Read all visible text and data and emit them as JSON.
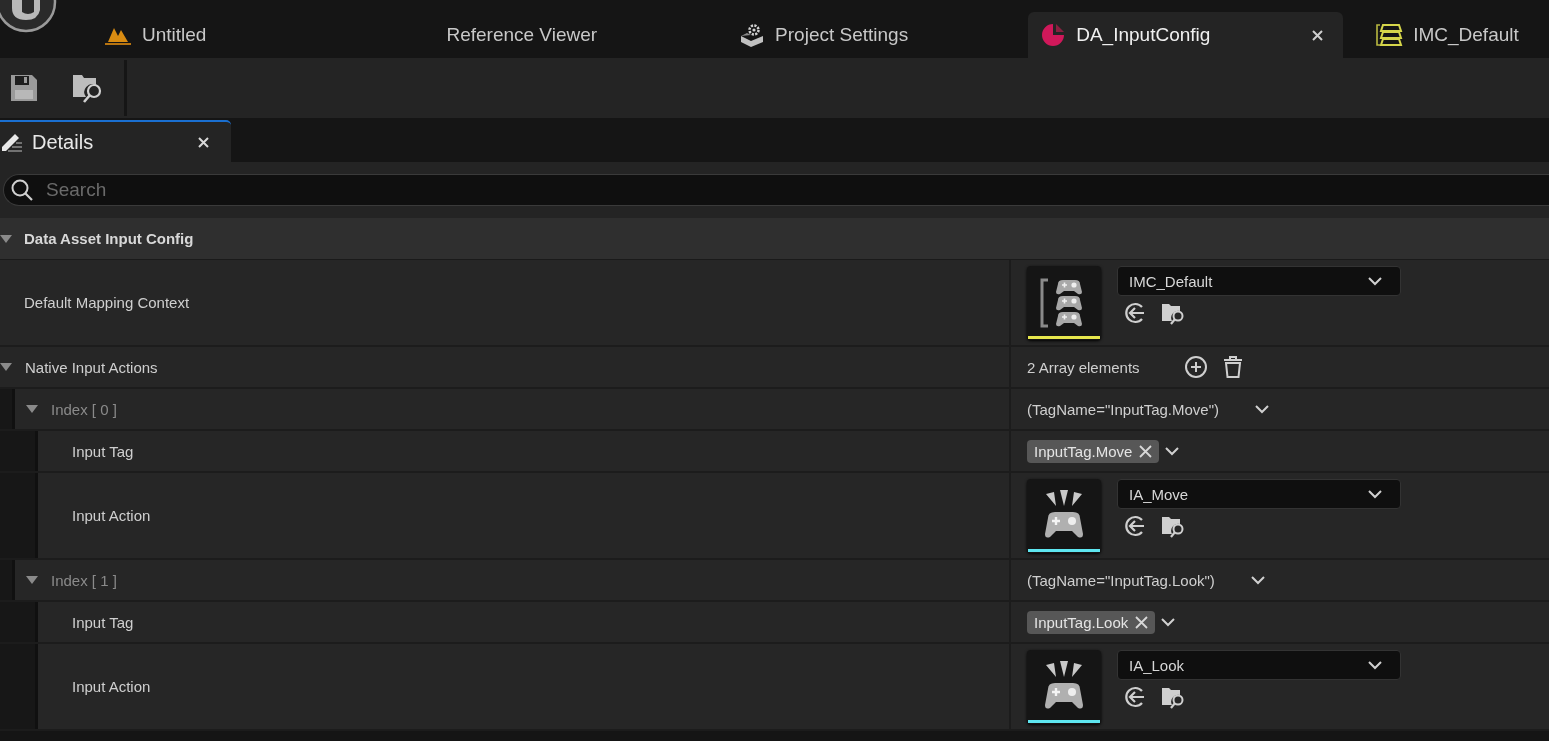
{
  "tabs": [
    {
      "label": "Untitled",
      "kind": "level",
      "selected": false
    },
    {
      "label": "Reference Viewer",
      "kind": "plain",
      "selected": false
    },
    {
      "label": "Project Settings",
      "kind": "settings",
      "selected": false
    },
    {
      "label": "DA_InputConfig",
      "kind": "dataasset",
      "selected": true
    },
    {
      "label": "IMC_Default",
      "kind": "mapping",
      "selected": false
    }
  ],
  "details": {
    "title": "Details",
    "search": {
      "placeholder": "Search"
    },
    "category": {
      "label": "Data Asset Input Config",
      "expanded": true
    },
    "rows": [
      {
        "kind": "context",
        "label": "Default Mapping Context",
        "value": "IMC_Default",
        "color": "#e6e64c"
      },
      {
        "kind": "array",
        "label": "Native Input Actions",
        "expanded": true,
        "count": "2 Array elements",
        "children": [
          {
            "kind": "element",
            "label": "Index [ 0 ]",
            "value": "(TagName=\"InputTag.Move\")",
            "expanded": true,
            "children": [
              {
                "kind": "tag",
                "label": "Input Tag",
                "tag": "InputTag.Move"
              },
              {
                "kind": "action",
                "label": "Input Action",
                "value": "IA_Move",
                "color": "#5ee6f0"
              }
            ]
          },
          {
            "kind": "element",
            "label": "Index [ 1 ]",
            "value": "(TagName=\"InputTag.Look\")",
            "expanded": true,
            "children": [
              {
                "kind": "tag",
                "label": "Input Tag",
                "tag": "InputTag.Look"
              },
              {
                "kind": "action",
                "label": "Input Action",
                "value": "IA_Look",
                "color": "#5ee6f0"
              }
            ]
          }
        ]
      }
    ]
  }
}
